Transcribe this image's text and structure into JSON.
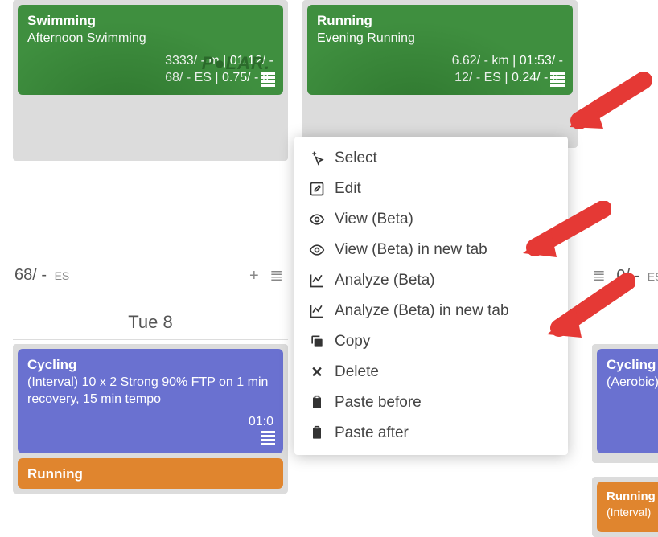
{
  "cards": {
    "swim": {
      "title": "Swimming",
      "subtitle": "Afternoon Swimming",
      "line1": "3333/ - m | 01:12/ -",
      "line2": "68/ -  ES  | 0.75/ -  IF"
    },
    "run": {
      "title": "Running",
      "subtitle": "Evening Running",
      "line1": "6.62/ - km | 01:53/ -",
      "line2": "12/ -  ES  | 0.24/ -  IF"
    },
    "cycle": {
      "title": "Cycling",
      "subtitle": "(Interval) 10 x 2 Strong 90% FTP on 1 min recovery, 15 min tempo",
      "line1": "01:0"
    },
    "run2": {
      "title": "Running"
    },
    "cycle2": {
      "title": "Cycling",
      "subtitle": "(Aerobic)"
    },
    "run3": {
      "title": "Running",
      "subtitle": "(Interval)"
    }
  },
  "polar_brand": "P●LAR.",
  "summary": {
    "left_value": "68/ -",
    "left_label": "ES",
    "right_value": "0/ -",
    "right_label": "ES"
  },
  "date_header": "Tue 8",
  "context_menu": {
    "select": "Select",
    "edit": "Edit",
    "view": "View (Beta)",
    "view_new_tab": "View (Beta) in new tab",
    "analyze": "Analyze (Beta)",
    "analyze_new_tab": "Analyze (Beta) in new tab",
    "copy": "Copy",
    "delete": "Delete",
    "paste_before": "Paste before",
    "paste_after": "Paste after"
  }
}
